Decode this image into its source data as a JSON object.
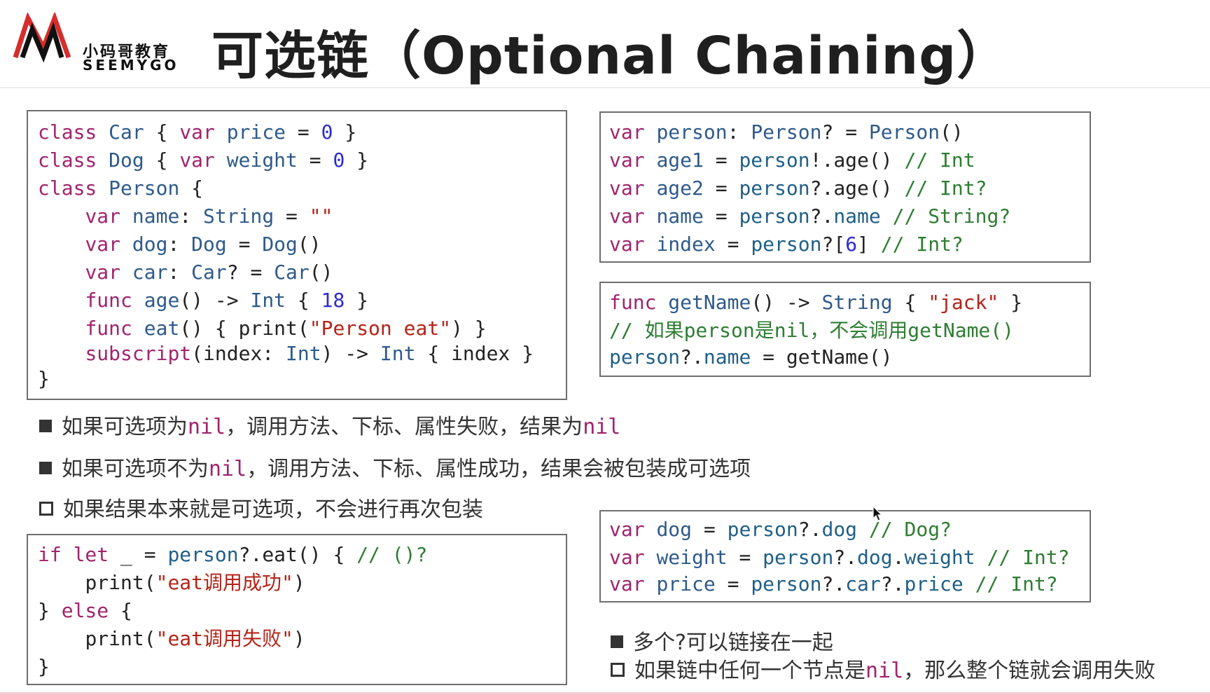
{
  "header": {
    "logo": {
      "cn": "小码哥教育",
      "en": "SEEMYGO"
    },
    "title": "可选链（Optional Chaining）"
  },
  "code_left_top": {
    "lines": [
      "class Car { var price = 0 }",
      "class Dog { var weight = 0 }",
      "class Person {",
      "    var name: String = \"\"",
      "    var dog: Dog = Dog()",
      "    var car: Car? = Car()",
      "    func age() -> Int { 18 }",
      "    func eat() { print(\"Person eat\") }",
      "    subscript(index: Int) -> Int { index }",
      "}"
    ]
  },
  "code_right_top": {
    "lines": [
      "var person: Person? = Person()",
      "var age1 = person!.age() // Int",
      "var age2 = person?.age() // Int?",
      "var name = person?.name // String?",
      "var index = person?[6] // Int?"
    ]
  },
  "code_right_mid": {
    "lines": [
      "func getName() -> String { \"jack\" }",
      "// 如果person是nil，不会调用getName()",
      "person?.name = getName()"
    ]
  },
  "bullets": [
    {
      "pre": "如果可选项为",
      "code": "nil",
      "post": "，调用方法、下标、属性失败，结果为",
      "code2": "nil"
    },
    {
      "pre": "如果可选项不为",
      "code": "nil",
      "post": "，调用方法、下标、属性成功，结果会被包装成可选项"
    },
    {
      "pre": "如果结果本来就是可选项，不会进行再次包装"
    }
  ],
  "code_left_bottom": {
    "lines": [
      "if let _ = person?.eat() { // ()?",
      "    print(\"eat调用成功\")",
      "} else {",
      "    print(\"eat调用失败\")",
      "}"
    ]
  },
  "code_right_bottom": {
    "lines": [
      "var dog = person?.dog // Dog?",
      "var weight = person?.dog.weight // Int?",
      "var price = person?.car?.price // Int?"
    ]
  },
  "bottom_bullets": [
    {
      "text": "多个?可以链接在一起"
    },
    {
      "pre": "如果链中任何一个节点是",
      "code": "nil",
      "post": "，那么整个链就会调用失败"
    }
  ],
  "icons": [
    "logo-m-icon",
    "cursor-arrow-icon"
  ]
}
